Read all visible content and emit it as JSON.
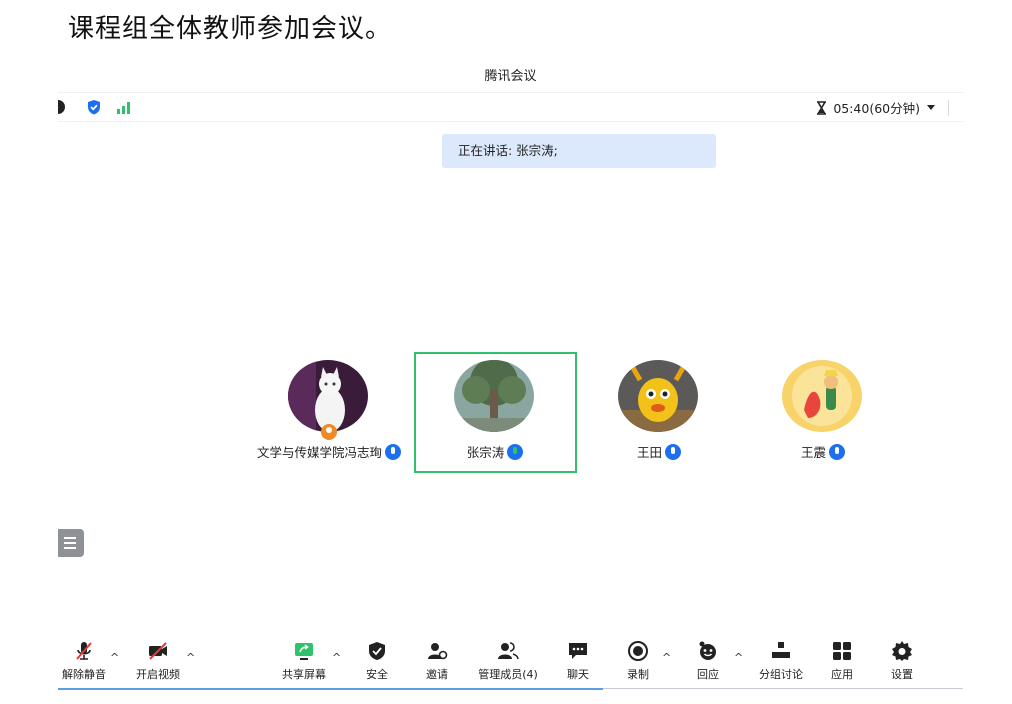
{
  "caption": "课程组全体教师参加会议。",
  "window": {
    "title": "腾讯会议"
  },
  "infobar": {
    "timer": "05:40(60分钟)"
  },
  "speaking": {
    "label": "正在讲话: 张宗涛;"
  },
  "participants": [
    {
      "name": "文学与传媒学院冯志珣"
    },
    {
      "name": "张宗涛"
    },
    {
      "name": "王田"
    },
    {
      "name": "王震"
    }
  ],
  "toolbar": {
    "unmute": "解除静音",
    "video": "开启视频",
    "share": "共享屏幕",
    "security": "安全",
    "invite": "邀请",
    "members": "管理成员(4)",
    "chat": "聊天",
    "record": "录制",
    "react": "回应",
    "breakout": "分组讨论",
    "apps": "应用",
    "settings": "设置"
  },
  "colors": {
    "accent": "#1e6ff0",
    "active": "#2fc26b",
    "speaking_bg": "#dce8fb"
  }
}
